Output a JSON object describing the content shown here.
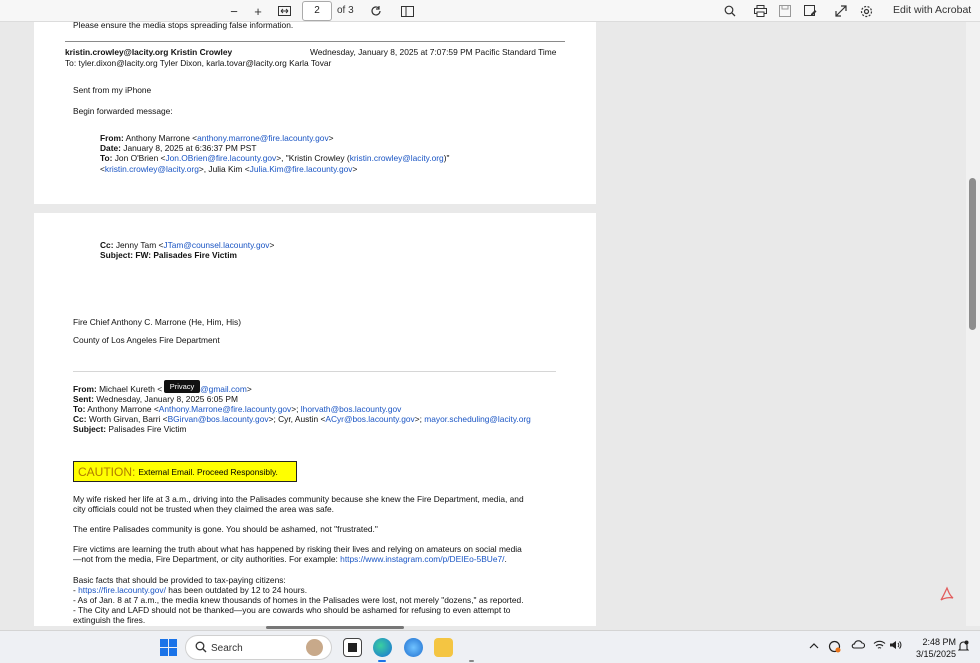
{
  "toolbar": {
    "zoom_out": "−",
    "zoom_in": "+",
    "page_current": "2",
    "page_of": "of 3",
    "edit_acrobat": "Edit with Acrobat"
  },
  "page1": {
    "top_line": "Please ensure the media stops spreading false information.",
    "sender": "kristin.crowley@lacity.org Kristin Crowley",
    "sent_time": "Wednesday, January 8, 2025 at 7:07:59 PM Pacific Standard Time",
    "to_line": "To: tyler.dixon@lacity.org Tyler Dixon, karla.tovar@lacity.org Karla Tovar",
    "sent_from": "Sent from my iPhone",
    "begin_fwd": "Begin forwarded message:",
    "from_label": "From:",
    "from_name": "Anthony Marrone <",
    "from_email": "anthony.marrone@fire.lacounty.gov",
    "from_end": ">",
    "date_label": "Date:",
    "date_value": "January 8, 2025 at 6:36:37 PM PST",
    "to_label": "To:",
    "to_1": "Jon O'Brien <",
    "to_1_email": "Jon.OBrien@fire.lacounty.gov",
    "to_2": ">, \"Kristin Crowley (",
    "to_2_email": "kristin.crowley@lacity.org",
    "to_3": ")\"",
    "to_4": "<",
    "to_4_email": "kristin.crowley@lacity.org",
    "to_5": ">, Julia Kim <",
    "to_5_email": "Julia.Kim@fire.lacounty.gov",
    "to_6": ">"
  },
  "page2": {
    "cc_label": "Cc:",
    "cc_name": "Jenny Tam <",
    "cc_email": "JTam@counsel.lacounty.gov",
    "cc_end": ">",
    "subject_line": "Subject: FW: Palisades Fire Victim",
    "sig_name": "Fire Chief Anthony C. Marrone (He, Him, His)",
    "sig_org": "County of Los Angeles Fire Department",
    "from_label": "From:",
    "from_name": "Michael Kureth <",
    "from_email": "@gmail.com",
    "from_end": ">",
    "privacy": "Privacy",
    "sent_label": "Sent:",
    "sent_value": "Wednesday, January 8, 2025 6:05 PM",
    "to_label": "To:",
    "to_name": "Anthony Marrone <",
    "to_email": "Anthony.Marrone@fire.lacounty.gov",
    "to_mid": ">; ",
    "to_email2": "lhorvath@bos.lacounty.gov",
    "cc2_label": "Cc:",
    "cc2_name": "Worth Girvan, Barri <",
    "cc2_email": "BGirvan@bos.lacounty.gov",
    "cc2_mid": ">; Cyr, Austin <",
    "cc2_email2": "ACyr@bos.lacounty.gov",
    "cc2_mid2": ">; ",
    "cc2_email3": "mayor.scheduling@lacity.org",
    "subject_label": "Subject:",
    "subject_value": "Palisades Fire Victim",
    "caution_word": "CAUTION:",
    "caution_text": "External Email. Proceed Responsibly.",
    "p1_l1": "My wife risked her life at 3 a.m., driving into the Palisades community because she knew the Fire Department, media, and",
    "p1_l2": "city officials could not be trusted when they claimed the area was safe.",
    "p2": "The entire Palisades community is gone. You should be ashamed, not \"frustrated.\"",
    "p3_l1": "Fire victims are learning the truth about what has happened by risking their lives and relying on amateurs on social media",
    "p3_l2": "—not from the media, Fire Department, or city authorities. For example: ",
    "p3_link": "https://www.instagram.com/p/DEIEo-5BUe7/",
    "p3_end": ".",
    "p4_head": "Basic facts that should be provided to tax-paying citizens:",
    "b1_dash": "- ",
    "b1_link": "https://fire.lacounty.gov/",
    "b1_rest": " has been outdated by 12 to 24 hours.",
    "b2": "- As of Jan. 8 at 7 a.m., the media knew thousands of homes in the Palisades were lost, not merely \"dozens,\" as reported.",
    "b3_l1": "- The City and LAFD should not be thanked—you are cowards who should be ashamed for refusing to even attempt to",
    "b3_l2": "extinguish the fires."
  },
  "taskbar": {
    "search_label": "Search",
    "time": "2:48 PM",
    "date": "3/15/2025"
  }
}
